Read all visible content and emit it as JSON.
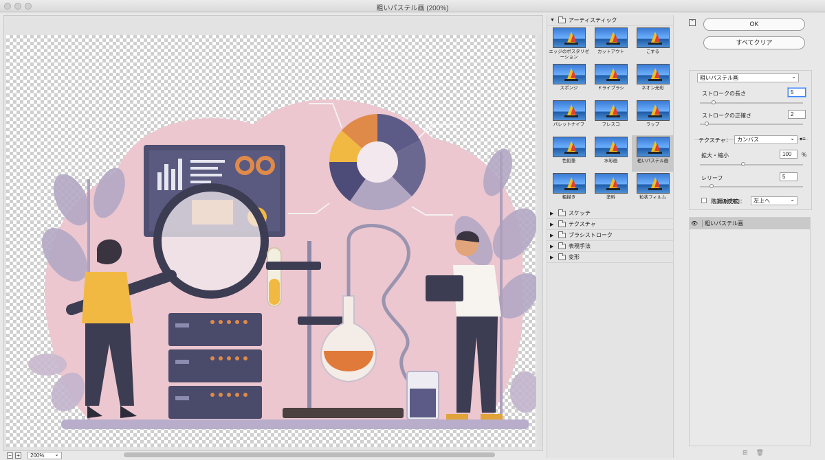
{
  "window": {
    "title": "粗いパステル画 (200%)"
  },
  "preview": {
    "zoom": "200%",
    "zoom_out": "−",
    "zoom_in": "+"
  },
  "gallery": {
    "open_group": "アーティスティック",
    "thumbnails": [
      {
        "label": "エッジのポスタリゼーション",
        "icon": "thumbnail-sailboat",
        "selected": false
      },
      {
        "label": "カットアウト",
        "icon": "thumbnail-sailboat",
        "selected": false
      },
      {
        "label": "こする",
        "icon": "thumbnail-sailboat",
        "selected": false
      },
      {
        "label": "スポンジ",
        "icon": "thumbnail-sailboat",
        "selected": false
      },
      {
        "label": "ドライブラシ",
        "icon": "thumbnail-sailboat",
        "selected": false
      },
      {
        "label": "ネオン光彩",
        "icon": "thumbnail-sailboat",
        "selected": false
      },
      {
        "label": "パレットナイフ",
        "icon": "thumbnail-sailboat",
        "selected": false
      },
      {
        "label": "フレスコ",
        "icon": "thumbnail-sailboat",
        "selected": false
      },
      {
        "label": "ラップ",
        "icon": "thumbnail-sailboat",
        "selected": false
      },
      {
        "label": "色鉛筆",
        "icon": "thumbnail-sailboat",
        "selected": false
      },
      {
        "label": "水彩画",
        "icon": "thumbnail-sailboat",
        "selected": false
      },
      {
        "label": "粗いパステル画",
        "icon": "thumbnail-sailboat",
        "selected": true
      },
      {
        "label": "粗描き",
        "icon": "thumbnail-sailboat",
        "selected": false
      },
      {
        "label": "塗料",
        "icon": "thumbnail-sailboat",
        "selected": false
      },
      {
        "label": "粒状フィルム",
        "icon": "thumbnail-sailboat",
        "selected": false
      }
    ],
    "closed_groups": [
      "スケッチ",
      "テクスチャ",
      "ブラシストローク",
      "表現手法",
      "変形"
    ]
  },
  "settings": {
    "ok_label": "OK",
    "clear_label": "すべてクリア",
    "filter_select": "粗いパステル画",
    "stroke_length_label": "ストロークの長さ",
    "stroke_length_value": "5",
    "stroke_detail_label": "ストロークの正確さ",
    "stroke_detail_value": "2",
    "texture_label": "テクスチャ：",
    "texture_value": "カンバス",
    "scaling_label": "拡大・縮小",
    "scaling_value": "100",
    "scaling_unit": "%",
    "relief_label": "レリーフ",
    "relief_value": "5",
    "light_label": "照射方向：",
    "light_value": "左上へ",
    "invert_label": "階調の反転",
    "invert_checked": false,
    "sliders": {
      "stroke_length": 0.12,
      "stroke_detail": 0.05,
      "scaling": 0.42,
      "relief": 0.1
    }
  },
  "layers": {
    "items": [
      {
        "name": "粗いパステル画",
        "visible": true
      }
    ]
  }
}
